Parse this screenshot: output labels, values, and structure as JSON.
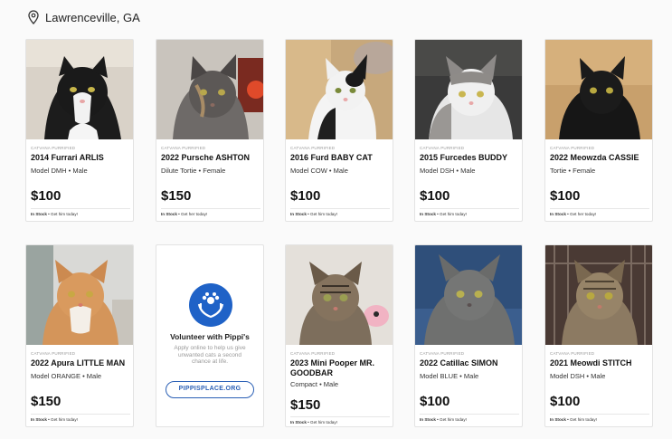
{
  "location": {
    "label": "Lawrenceville, GA"
  },
  "cards": [
    {
      "badge": "CATVANA PURRIFIED",
      "title": "2014 Furrari ARLIS",
      "sub": "Model DMH • Male",
      "price": "$100",
      "stock_label": "In Stock",
      "stock_note": " • Get him today!"
    },
    {
      "badge": "CATVANA PURRIFIED",
      "title": "2022 Pursche ASHTON",
      "sub": "Dilute Tortie • Female",
      "price": "$150",
      "stock_label": "In Stock",
      "stock_note": " • Get her today!"
    },
    {
      "badge": "CATVANA PURRIFIED",
      "title": "2016 Furd BABY CAT",
      "sub": "Model COW • Male",
      "price": "$100",
      "stock_label": "In Stock",
      "stock_note": " • Get him today!"
    },
    {
      "badge": "CATVANA PURRIFIED",
      "title": "2015 Furcedes BUDDY",
      "sub": "Model DSH • Male",
      "price": "$100",
      "stock_label": "In Stock",
      "stock_note": " • Get him today!"
    },
    {
      "badge": "CATVANA PURRIFIED",
      "title": "2022 Meowzda CASSIE",
      "sub": "Tortie • Female",
      "price": "$100",
      "stock_label": "In Stock",
      "stock_note": " • Get her today!"
    },
    {
      "badge": "CATVANA PURRIFIED",
      "title": "2022 Apura LITTLE MAN",
      "sub": "Model ORANGE • Male",
      "price": "$150",
      "stock_label": "In Stock",
      "stock_note": " • Get him today!"
    },
    {
      "badge": "CATVANA PURRIFIED",
      "title": "2023 Mini Pooper MR. GOODBAR",
      "sub": "Compact • Male",
      "price": "$150",
      "stock_label": "In Stock",
      "stock_note": " • Get him today!"
    },
    {
      "badge": "CATVANA PURRIFIED",
      "title": "2022 Catillac SIMON",
      "sub": "Model BLUE • Male",
      "price": "$100",
      "stock_label": "In Stock",
      "stock_note": " • Get him today!"
    },
    {
      "badge": "CATVANA PURRIFIED",
      "title": "2021 Meowdi STITCH",
      "sub": "Model DSH • Male",
      "price": "$100",
      "stock_label": "In Stock",
      "stock_note": " • Get him today!"
    }
  ],
  "volunteer": {
    "title": "Volunteer with Pippi's",
    "text": "Apply online to help us give unwanted cats a second chance at life.",
    "link": "PIPPISPLACE.ORG",
    "brand_color": "#1f62c7"
  }
}
